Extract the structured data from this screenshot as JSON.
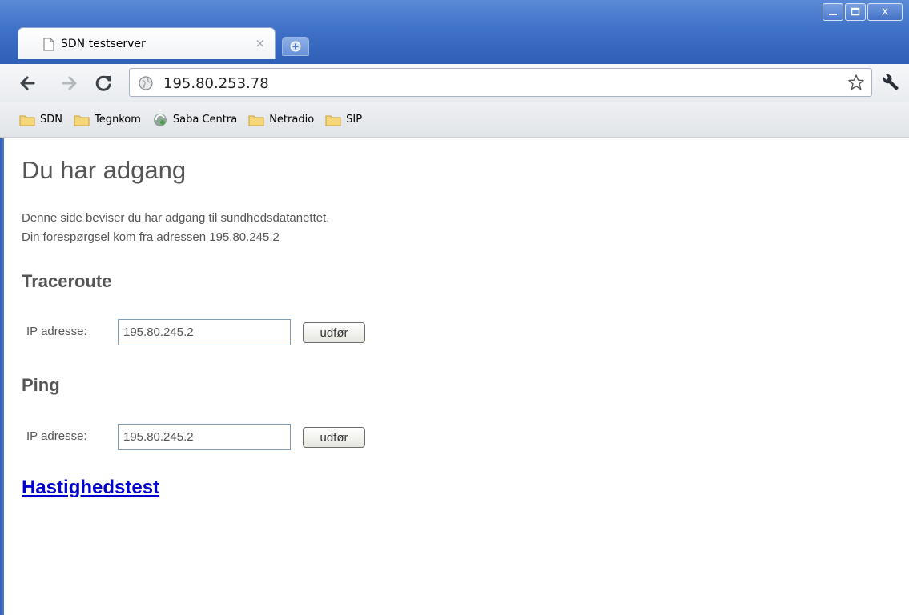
{
  "browser": {
    "tab_title": "SDN testserver",
    "tab_close_symbol": "×",
    "url": "195.80.253.78",
    "window_controls": {
      "minimize": "minimize-icon",
      "maximize": "maximize-icon",
      "close": "X"
    }
  },
  "bookmarks": [
    {
      "label": "SDN",
      "icon": "folder-icon"
    },
    {
      "label": "Tegnkom",
      "icon": "folder-icon"
    },
    {
      "label": "Saba Centra",
      "icon": "saba-icon"
    },
    {
      "label": "Netradio",
      "icon": "folder-icon"
    },
    {
      "label": "SIP",
      "icon": "folder-icon"
    }
  ],
  "page": {
    "heading": "Du har adgang",
    "line1": "Denne side beviser du har adgang til sundhedsdatanettet.",
    "line2": "Din forespørgsel kom fra adressen 195.80.245.2",
    "traceroute": {
      "title": "Traceroute",
      "label": "IP adresse:",
      "value": "195.80.245.2",
      "button": "udfør"
    },
    "ping": {
      "title": "Ping",
      "label": "IP adresse:",
      "value": "195.80.245.2",
      "button": "udfør"
    },
    "speedtest_link": "Hastighedstest"
  },
  "colors": {
    "titlebar": "#3f72c8",
    "text": "#555555",
    "link": "#0000cc"
  }
}
